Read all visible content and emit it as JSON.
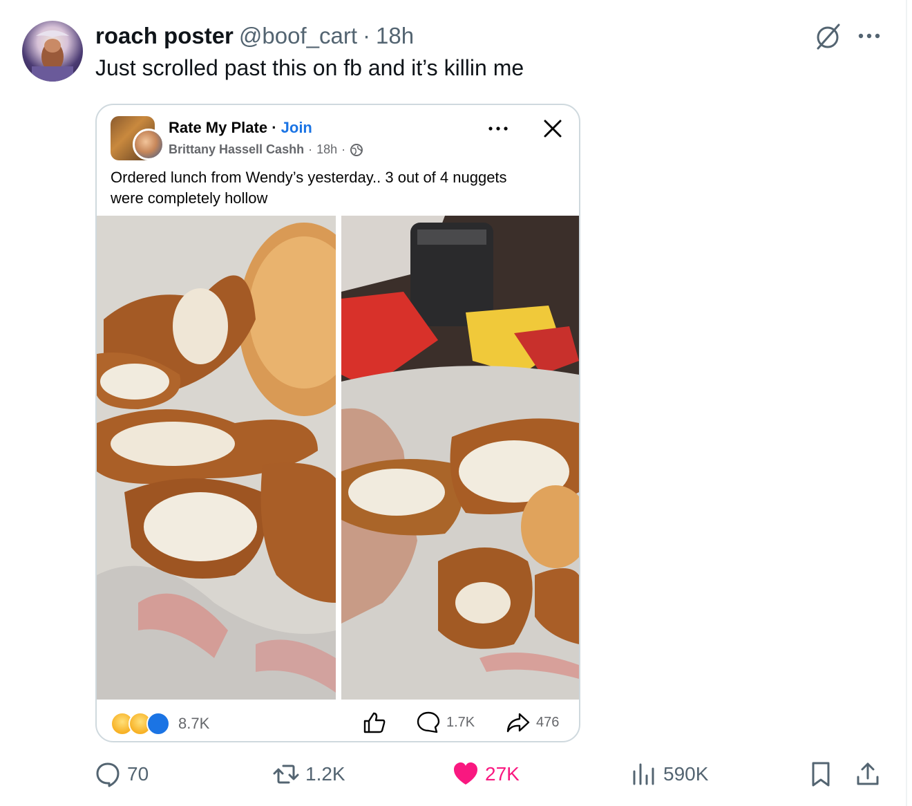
{
  "post": {
    "display_name": "roach poster",
    "handle": "@boof_cart",
    "separator": "·",
    "time": "18h",
    "text": "Just scrolled past this on fb and it’s killin me",
    "icons": {
      "grok": "grok-slash-icon",
      "more": "more-horizontal-icon"
    }
  },
  "embedded_post": {
    "group_name": "Rate My Plate",
    "separator": "·",
    "join_label": "Join",
    "author": "Brittany Hassell Cashh",
    "time": "18h",
    "caption": "Ordered lunch from Wendy’s yesterday.. 3 out of 4 nuggets were completely hollow",
    "reaction_count": "8.7K",
    "comment_count": "1.7K",
    "share_count": "476",
    "reactions": [
      "haha",
      "wow",
      "like"
    ]
  },
  "actions": {
    "replies": "70",
    "reposts": "1.2K",
    "likes": "27K",
    "views": "590K"
  },
  "colors": {
    "text": "#0f1419",
    "muted": "#536471",
    "like_pink": "#f91880",
    "fb_blue": "#1b74e4",
    "border": "#cfd9de"
  }
}
